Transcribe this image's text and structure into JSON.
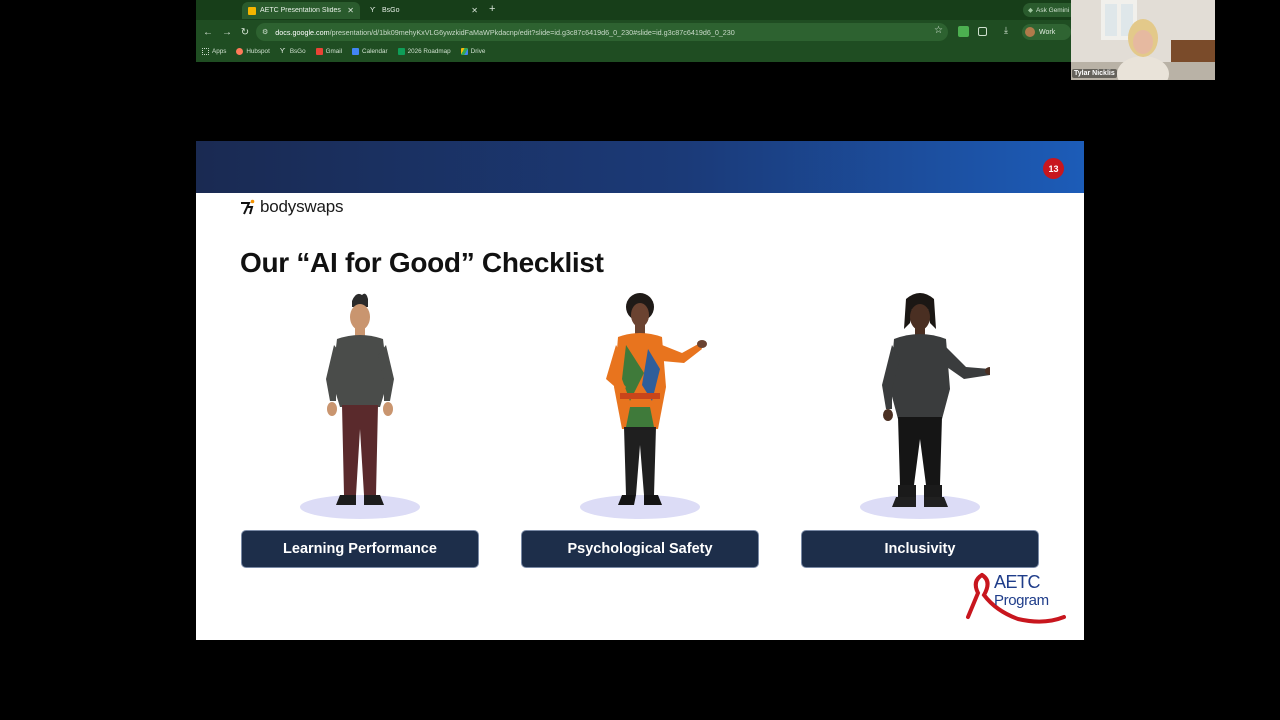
{
  "browser": {
    "tabs": [
      {
        "label": "AETC Presentation Slides (NI",
        "favicon": "slides-icon",
        "active": true
      },
      {
        "label": "BsGo",
        "favicon": "bodyswaps-icon",
        "active": false
      }
    ],
    "new_tab": "+",
    "side_button": "Ask Gemini",
    "url_host": "docs.google.com",
    "url_path": "/presentation/d/1bk09mehyKxVLG6ywzkidFaMaWPkdacnp/edit?slide=id.g3c87c6419d6_0_230#slide=id.g3c87c6419d6_0_230",
    "profile_label": "Work",
    "bookmarks": [
      {
        "label": "Apps",
        "icon": "apps-grid-icon"
      },
      {
        "label": "Hubspot",
        "icon": "hubspot-icon"
      },
      {
        "label": "BsGo",
        "icon": "bodyswaps-icon"
      },
      {
        "label": "Gmail",
        "icon": "gmail-icon"
      },
      {
        "label": "Calendar",
        "icon": "calendar-icon"
      },
      {
        "label": "2026 Roadmap",
        "icon": "sheets-icon"
      },
      {
        "label": "Drive",
        "icon": "drive-icon"
      }
    ]
  },
  "slide": {
    "number": "13",
    "brand": "bodyswaps",
    "title": "Our “AI for Good” Checklist",
    "pillars": [
      {
        "label": "Learning Performance",
        "figure": "avatar-man-grey-shirt"
      },
      {
        "label": "Psychological Safety",
        "figure": "avatar-woman-patterned-top"
      },
      {
        "label": "Inclusivity",
        "figure": "avatar-man-dreadlocks"
      }
    ],
    "logo_line1": "AETC",
    "logo_line2": "Program"
  },
  "webcam": {
    "participant_name": "Tylar Nicklis"
  },
  "colors": {
    "browser_frame": "#1f4d22",
    "banner_start": "#1a2a52",
    "banner_end": "#1c5cb8",
    "pill_fill": "#1d2e4a",
    "slide_number_badge": "#c8161e",
    "aetc_blue": "#1f3d8a",
    "aetc_red": "#c8161e"
  }
}
